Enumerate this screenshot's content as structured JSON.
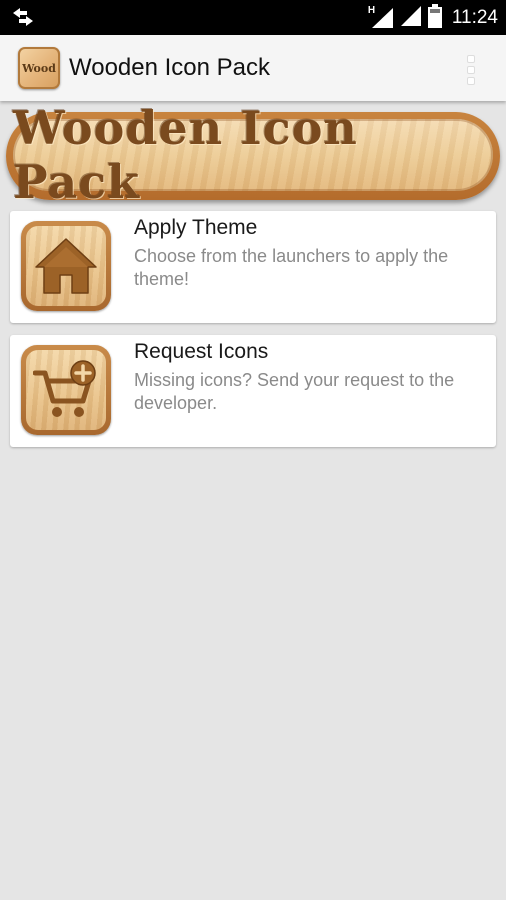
{
  "status_bar": {
    "time": "11:24",
    "network_type": "H",
    "icons": [
      "data-transfer-icon",
      "signal-icon",
      "wifi-signal-icon",
      "battery-icon"
    ]
  },
  "app_bar": {
    "logo_text": "Wood",
    "title": "Wooden Icon Pack",
    "menu_icon": "overflow-menu-icon"
  },
  "banner": {
    "text": "Wooden Icon Pack"
  },
  "cards": [
    {
      "icon": "home-icon",
      "title": "Apply Theme",
      "description": "Choose from the launchers to apply the theme!"
    },
    {
      "icon": "cart-add-icon",
      "title": "Request Icons",
      "description": "Missing icons? Send your request to the developer."
    }
  ],
  "colors": {
    "background": "#e5e5e5",
    "app_bar": "#f5f5f5",
    "wood_light": "#f3d7a8",
    "wood_dark": "#a8682e",
    "engraving": "#7a4a1e"
  }
}
